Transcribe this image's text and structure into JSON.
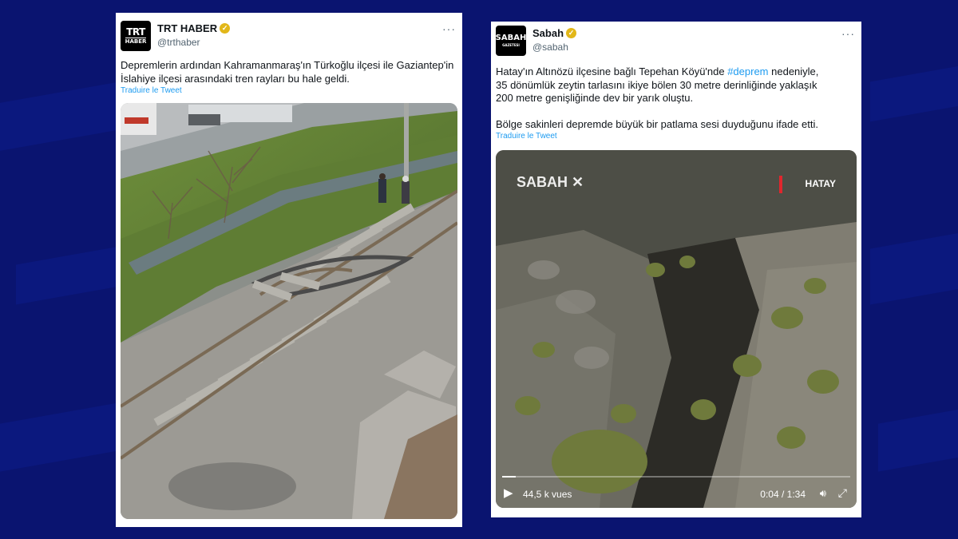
{
  "tweet1": {
    "name": "TRT HABER",
    "handle": "@trthaber",
    "avatar_line1": "TRT",
    "avatar_line2": "HABER",
    "text_line1": "Depremlerin ardından Kahramanmaraş'ın Türkoğlu ilçesi ile Gaziantep'in",
    "text_line2": "İslahiye ilçesi arasındaki tren rayları bu hale geldi.",
    "translate": "Traduire le Tweet",
    "more_icon": "more-options-icon"
  },
  "tweet2": {
    "name": "Sabah",
    "handle": "@sabah",
    "avatar_line1": "SABAH",
    "avatar_line2": "GAZETESI",
    "text_line1_pre": "Hatay'ın Altınözü ilçesine bağlı Tepehan Köyü'nde ",
    "hashtag": "#deprem",
    "text_line1_post": " nedeniyle,",
    "text_line2": "35 dönümlük zeytin tarlasını ikiye bölen 30 metre derinliğinde yaklaşık",
    "text_line3": "200 metre genişliğinde dev bir yarık oluştu.",
    "text_line4": "Bölge sakinleri depremde büyük bir patlama sesi duyduğunu ifade etti.",
    "translate": "Traduire le Tweet",
    "video": {
      "watermark": "SABAH",
      "location": "HATAY",
      "views": "44,5 k vues",
      "time": "0:04 / 1:34",
      "progress": 0.04
    }
  },
  "colors": {
    "background": "#0a1470",
    "link": "#1d9bf0",
    "verified": "#e2b719"
  }
}
